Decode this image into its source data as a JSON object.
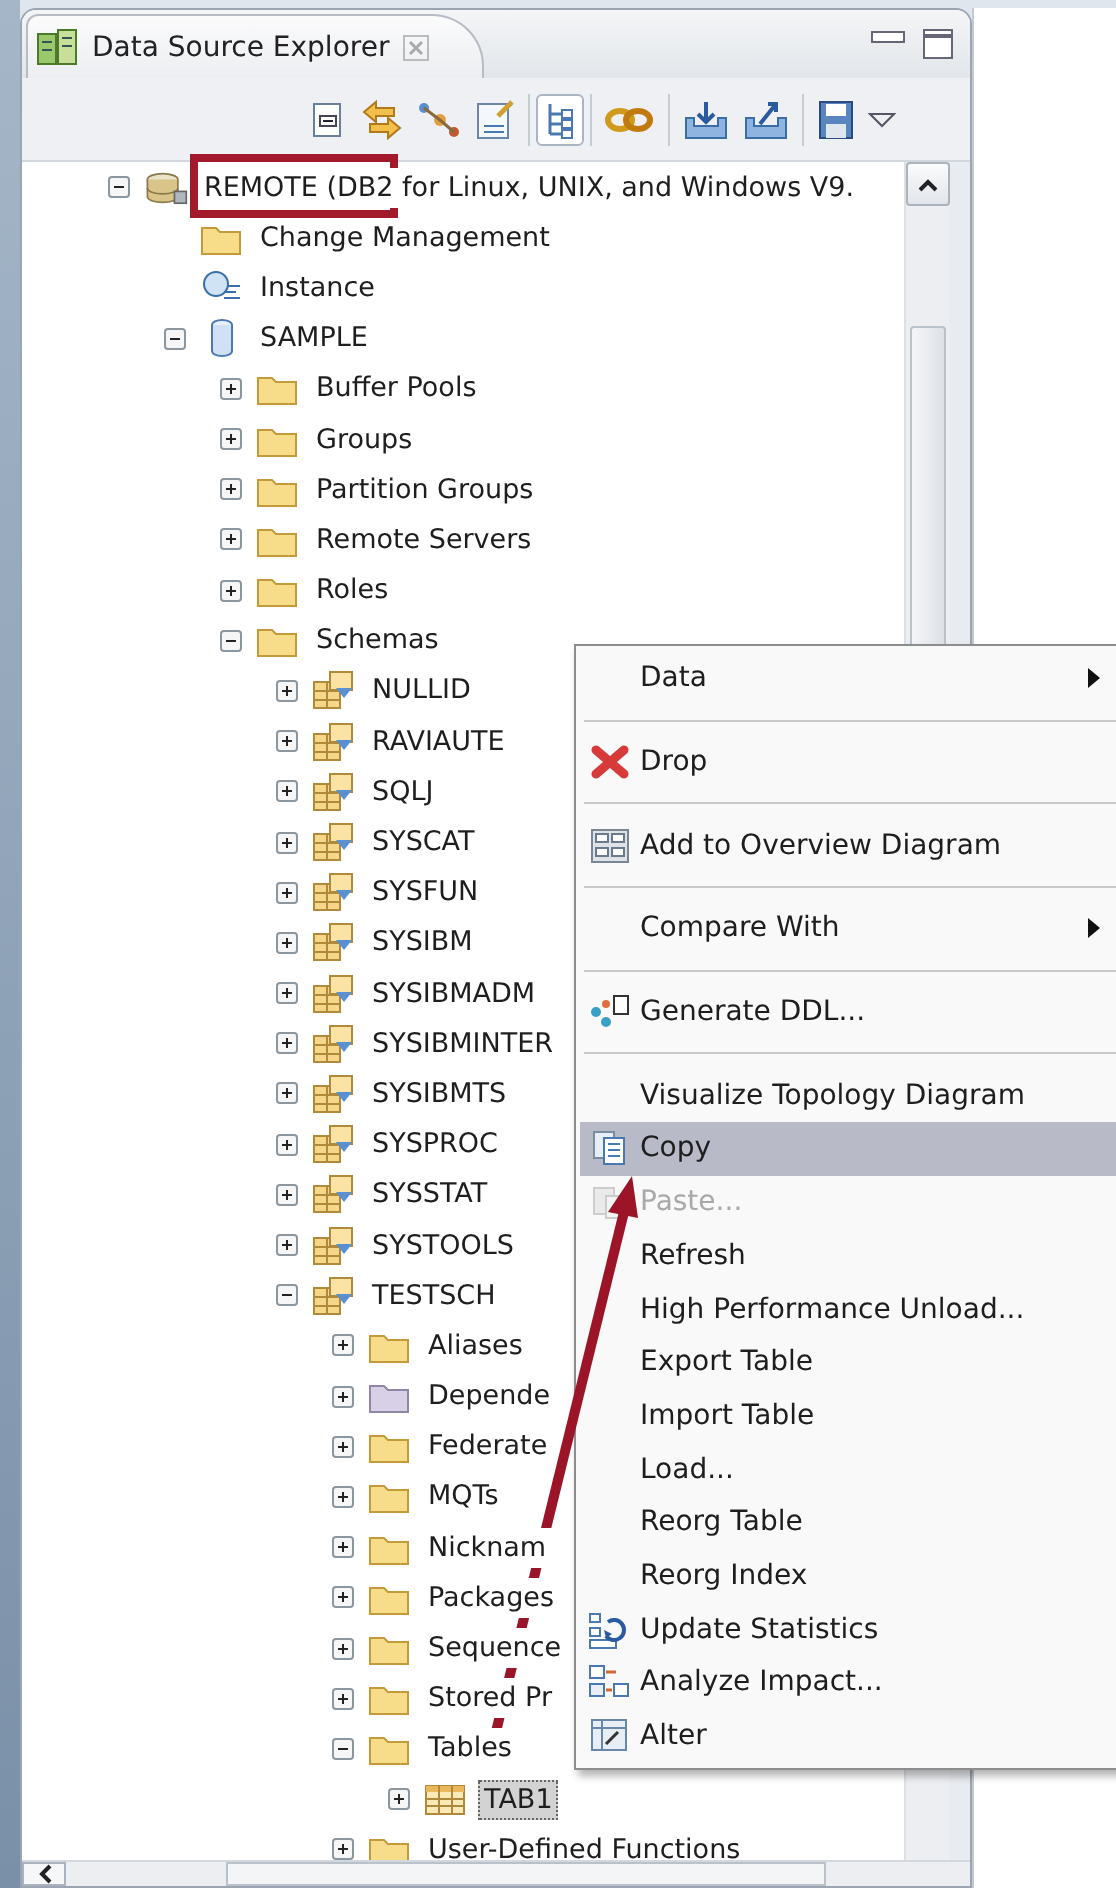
{
  "panel": {
    "title": "Data Source Explorer"
  },
  "toolbar": [
    {
      "kind": "collapse",
      "pressed": false
    },
    {
      "kind": "sync",
      "pressed": false
    },
    {
      "kind": "nodes",
      "pressed": false
    },
    {
      "kind": "sql",
      "pressed": false
    },
    {
      "kind": "separator"
    },
    {
      "kind": "tree",
      "pressed": true
    },
    {
      "kind": "separator"
    },
    {
      "kind": "chain",
      "pressed": false
    },
    {
      "kind": "separator"
    },
    {
      "kind": "import",
      "pressed": false
    },
    {
      "kind": "export",
      "pressed": false
    },
    {
      "kind": "separator"
    },
    {
      "kind": "save",
      "pressed": false
    },
    {
      "kind": "viewmenu",
      "pressed": false
    }
  ],
  "tree": [
    {
      "label": "REMOTE (DB2 for Linux, UNIX, and Windows V9.",
      "kind": "connection",
      "expanded": true,
      "selected": false,
      "children": [
        {
          "label": "Change Management",
          "kind": "folder",
          "selected": false
        },
        {
          "label": "Instance",
          "kind": "instance",
          "selected": false
        },
        {
          "label": "SAMPLE",
          "kind": "database",
          "expanded": true,
          "selected": false,
          "children": [
            {
              "label": "Buffer Pools",
              "kind": "folder",
              "expanded": false,
              "selected": false
            },
            {
              "label": "Groups",
              "kind": "folder",
              "expanded": false,
              "selected": false
            },
            {
              "label": "Partition Groups",
              "kind": "folder",
              "expanded": false,
              "selected": false
            },
            {
              "label": "Remote Servers",
              "kind": "folder",
              "expanded": false,
              "selected": false
            },
            {
              "label": "Roles",
              "kind": "folder",
              "expanded": false,
              "selected": false
            },
            {
              "label": "Schemas",
              "kind": "folder",
              "expanded": true,
              "selected": false,
              "children": [
                {
                  "label": "NULLID",
                  "kind": "schema",
                  "expanded": false,
                  "selected": false
                },
                {
                  "label": "RAVIAUTE",
                  "kind": "schema",
                  "expanded": false,
                  "selected": false
                },
                {
                  "label": "SQLJ",
                  "kind": "schema",
                  "expanded": false,
                  "selected": false
                },
                {
                  "label": "SYSCAT",
                  "kind": "schema",
                  "expanded": false,
                  "selected": false
                },
                {
                  "label": "SYSFUN",
                  "kind": "schema",
                  "expanded": false,
                  "selected": false
                },
                {
                  "label": "SYSIBM",
                  "kind": "schema",
                  "expanded": false,
                  "selected": false
                },
                {
                  "label": "SYSIBMADM",
                  "kind": "schema",
                  "expanded": false,
                  "selected": false
                },
                {
                  "label": "SYSIBMINTER",
                  "kind": "schema",
                  "expanded": false,
                  "selected": false
                },
                {
                  "label": "SYSIBMTS",
                  "kind": "schema",
                  "expanded": false,
                  "selected": false
                },
                {
                  "label": "SYSPROC",
                  "kind": "schema",
                  "expanded": false,
                  "selected": false
                },
                {
                  "label": "SYSSTAT",
                  "kind": "schema",
                  "expanded": false,
                  "selected": false
                },
                {
                  "label": "SYSTOOLS",
                  "kind": "schema",
                  "expanded": false,
                  "selected": false
                },
                {
                  "label": "TESTSCH",
                  "kind": "schema",
                  "expanded": true,
                  "selected": false,
                  "children": [
                    {
                      "label": "Aliases",
                      "kind": "folder",
                      "expanded": false,
                      "selected": false
                    },
                    {
                      "label": "Depende",
                      "kind": "vfolder",
                      "expanded": false,
                      "selected": false
                    },
                    {
                      "label": "Federate",
                      "kind": "folder",
                      "expanded": false,
                      "selected": false
                    },
                    {
                      "label": "MQTs",
                      "kind": "folder",
                      "expanded": false,
                      "selected": false
                    },
                    {
                      "label": "Nicknam",
                      "kind": "folder",
                      "expanded": false,
                      "selected": false
                    },
                    {
                      "label": "Packages",
                      "kind": "folder",
                      "expanded": false,
                      "selected": false
                    },
                    {
                      "label": "Sequence",
                      "kind": "folder",
                      "expanded": false,
                      "selected": false
                    },
                    {
                      "label": "Stored Pr",
                      "kind": "folder",
                      "expanded": false,
                      "selected": false
                    },
                    {
                      "label": "Tables",
                      "kind": "folder",
                      "expanded": true,
                      "selected": false,
                      "children": [
                        {
                          "label": "TAB1",
                          "kind": "table",
                          "expanded": false,
                          "selected": true
                        }
                      ]
                    },
                    {
                      "label": "User-Defined Functions",
                      "kind": "folder",
                      "expanded": false,
                      "selected": false
                    }
                  ]
                }
              ]
            }
          ]
        }
      ]
    }
  ],
  "context_menu": {
    "items": [
      {
        "label": "Data",
        "kind": "submenu",
        "selected": false,
        "disabled": false
      },
      {
        "kind": "separator"
      },
      {
        "label": "Drop",
        "kind": "drop",
        "selected": false,
        "disabled": false
      },
      {
        "kind": "separator"
      },
      {
        "label": "Add to Overview Diagram",
        "kind": "diagram",
        "selected": false,
        "disabled": false
      },
      {
        "kind": "separator"
      },
      {
        "label": "Compare With",
        "kind": "submenu",
        "selected": false,
        "disabled": false
      },
      {
        "kind": "separator"
      },
      {
        "label": "Generate DDL...",
        "kind": "ddl",
        "selected": false,
        "disabled": false
      },
      {
        "kind": "separator"
      },
      {
        "label": "Visualize Topology Diagram",
        "kind": "plain",
        "selected": false,
        "disabled": false
      },
      {
        "label": "Copy",
        "kind": "copy",
        "selected": true,
        "disabled": false
      },
      {
        "label": "Paste...",
        "kind": "paste",
        "selected": false,
        "disabled": true
      },
      {
        "label": "Refresh",
        "kind": "plain",
        "selected": false,
        "disabled": false
      },
      {
        "label": "High Performance Unload...",
        "kind": "plain",
        "selected": false,
        "disabled": false
      },
      {
        "label": "Export Table",
        "kind": "plain",
        "selected": false,
        "disabled": false
      },
      {
        "label": "Import Table",
        "kind": "plain",
        "selected": false,
        "disabled": false
      },
      {
        "label": "Load...",
        "kind": "plain",
        "selected": false,
        "disabled": false
      },
      {
        "label": "Reorg Table",
        "kind": "plain",
        "selected": false,
        "disabled": false
      },
      {
        "label": "Reorg Index",
        "kind": "plain",
        "selected": false,
        "disabled": false
      },
      {
        "label": "Update Statistics",
        "kind": "stats",
        "selected": false,
        "disabled": false
      },
      {
        "label": "Analyze Impact...",
        "kind": "impact",
        "selected": false,
        "disabled": false
      },
      {
        "label": "Alter",
        "kind": "alter",
        "selected": false,
        "disabled": false
      }
    ]
  }
}
